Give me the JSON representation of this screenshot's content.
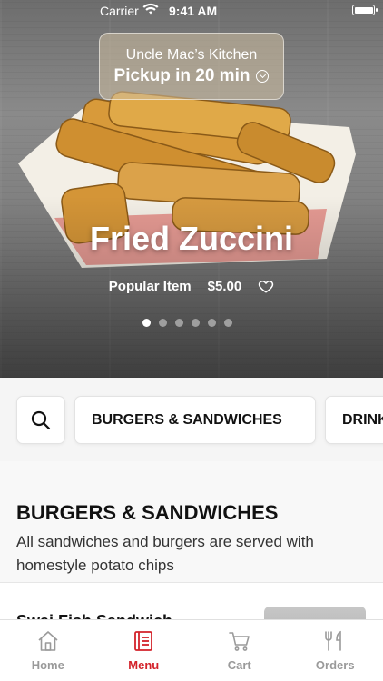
{
  "status_bar": {
    "carrier": "Carrier",
    "time": "9:41 AM"
  },
  "pickup": {
    "restaurant": "Uncle Mac’s Kitchen",
    "pickup_time": "Pickup in 20 min"
  },
  "hero": {
    "item_name": "Fried Zuccini",
    "tag": "Popular Item",
    "price": "$5.00",
    "carousel": {
      "count": 6,
      "active_index": 0
    }
  },
  "categories": [
    "BURGERS & SANDWICHES",
    "DRINKS"
  ],
  "section": {
    "title": "BURGERS & SANDWICHES",
    "description": "All sandwiches and burgers are served with homestyle potato chips"
  },
  "menu_items": [
    {
      "name": "Swai Fish Sandwich"
    }
  ],
  "tabs": [
    {
      "label": "Home",
      "icon": "home-icon",
      "active": false
    },
    {
      "label": "Menu",
      "icon": "menu-icon",
      "active": true
    },
    {
      "label": "Cart",
      "icon": "cart-icon",
      "active": false
    },
    {
      "label": "Orders",
      "icon": "orders-icon",
      "active": false
    }
  ],
  "colors": {
    "accent": "#d3222a",
    "inactive": "#9a9a9a"
  }
}
